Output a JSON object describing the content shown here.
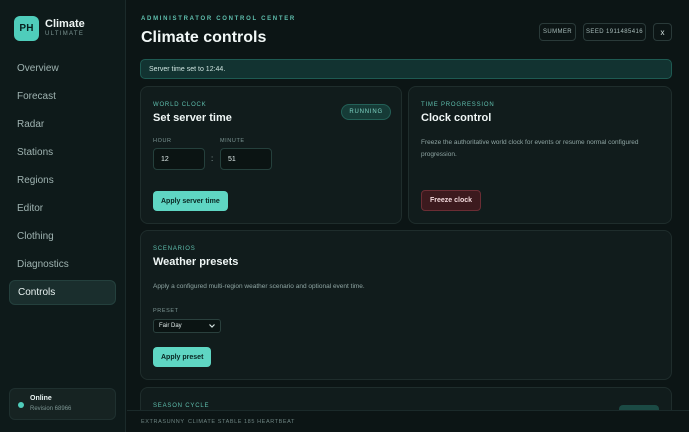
{
  "brand": {
    "logo": "PH",
    "title": "Climate",
    "subtitle": "ULTIMATE"
  },
  "nav": [
    "Overview",
    "Forecast",
    "Radar",
    "Stations",
    "Regions",
    "Editor",
    "Clothing",
    "Diagnostics",
    "Controls"
  ],
  "active_nav": "Controls",
  "status": {
    "title": "Online",
    "revision": "Revision 68966"
  },
  "header": {
    "eyebrow": "ADMINISTRATOR CONTROL CENTER",
    "title": "Climate controls",
    "season_chip": "SUMMER",
    "seed_chip": "SEED 1911485416",
    "close": "x"
  },
  "toast": "Server time set to 12:44.",
  "world_clock": {
    "eyebrow": "WORLD CLOCK",
    "title": "Set server time",
    "badge": "RUNNING",
    "hour_label": "HOUR",
    "hour_value": "12",
    "minute_label": "MINUTE",
    "minute_value": "51",
    "separator": ":",
    "apply_button": "Apply server time"
  },
  "time_progression": {
    "eyebrow": "TIME PROGRESSION",
    "title": "Clock control",
    "text": "Freeze the authoritative world clock for events or resume normal configured progression.",
    "freeze_button": "Freeze clock"
  },
  "scenarios": {
    "eyebrow": "SCENARIOS",
    "title": "Weather presets",
    "text": "Apply a configured multi-region weather scenario and optional event time.",
    "preset_label": "PRESET",
    "preset_value": "Fair Day",
    "apply_button": "Apply preset"
  },
  "season_cycle": {
    "eyebrow": "SEASON CYCLE"
  },
  "footer": [
    "EXTRASUNNY",
    "CLIMATE STABLE",
    "185 HEARTBEAT"
  ],
  "colors": {
    "accent": "#5fd6c3",
    "background": "#0c1515",
    "danger": "#3c1a1e"
  }
}
